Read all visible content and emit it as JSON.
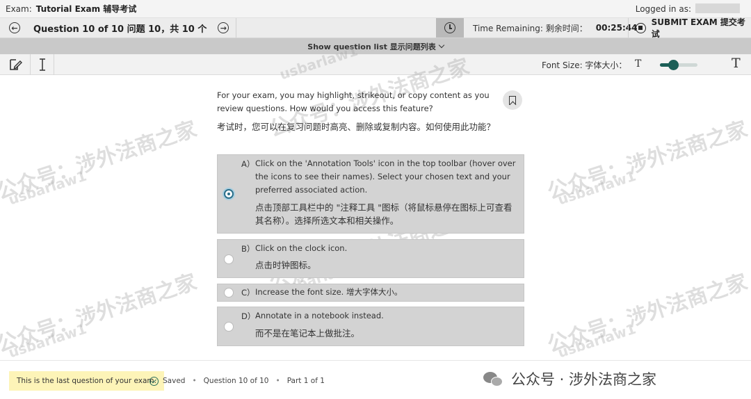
{
  "header": {
    "exam_label": "Exam:",
    "exam_name": "Tutorial Exam 辅导考试",
    "logged_in_label": "Logged in as:"
  },
  "nav": {
    "question_counter": "Question 10 of 10 问题 10，共 10 个",
    "time_label": "Time Remaining: 剩余时间：",
    "time_value": "00:25:44",
    "submit_label": "SUBMIT EXAM 提交考试",
    "prev_icon": "arrow-left-icon",
    "next_icon": "arrow-right-icon",
    "clock_icon": "clock-icon",
    "stop_icon": "stop-icon"
  },
  "question_list": {
    "toggle_label": "Show question list 显示问题列表"
  },
  "toolbar": {
    "annotate_icon": "annotate-icon",
    "text_cursor_icon": "text-cursor-icon",
    "font_size_label": "Font Size: 字体大小：",
    "font_small_glyph": "T",
    "font_large_glyph": "T",
    "font_slider_value": 0.35
  },
  "question": {
    "stem_en": "For your exam, you may highlight, strikeout, or copy content as you review questions. How would you access this feature?",
    "stem_cn": "考试时，您可以在复习问题时高亮、删除或复制内容。如何使用此功能？",
    "options": [
      {
        "letter": "A）",
        "text_en": "Click on the 'Annotation Tools' icon in the top toolbar (hover over the icons to see their names). Select your chosen text and your preferred associated action.",
        "text_cn": "点击顶部工具栏中的 \"注释工具 \"图标（将鼠标悬停在图标上可查看其名称）。选择所选文本和相关操作。",
        "selected": true
      },
      {
        "letter": "B）",
        "text_en": "Click on the clock icon.",
        "text_cn": "点击时钟图标。",
        "selected": false
      },
      {
        "letter": "C）",
        "text_en": "Increase the font size. 增大字体大小。",
        "text_cn": "",
        "selected": false
      },
      {
        "letter": "D）",
        "text_en": "Annotate in a notebook instead.",
        "text_cn": "而不是在笔记本上做批注。",
        "selected": false
      }
    ]
  },
  "footer": {
    "last_question_notice": "This is the last question of your exam.",
    "saved_label": "Saved",
    "question_position": "Question 10 of 10",
    "part_position": "Part 1 of 1",
    "separator": "•"
  },
  "watermark": {
    "brand_text": "公众号 · 涉外法商之家",
    "wm_cn": "公众号：涉外法商之家",
    "wm_en": "usbarlaw1"
  },
  "colors": {
    "accent": "#1c5f57",
    "selected_radio": "#2b6f8a",
    "notice_bg": "#fdf4b8",
    "option_bg": "#d3d3d3"
  }
}
